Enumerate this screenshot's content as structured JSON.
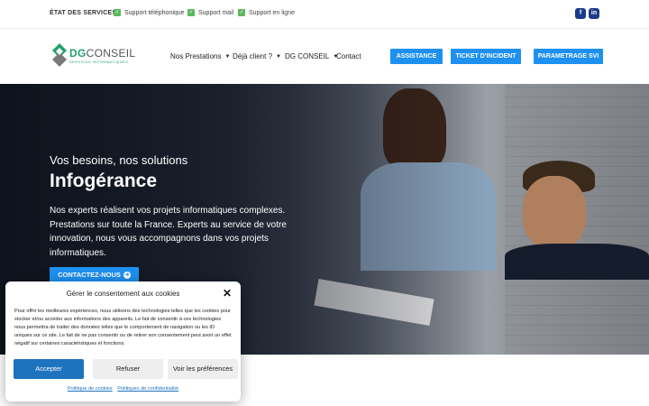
{
  "topbar": {
    "status_title": "ÉTAT DES SERVICES :",
    "services": [
      "Support téléphonique",
      "Support mail",
      "Support en ligne"
    ],
    "social": [
      "facebook-icon",
      "linkedin-icon"
    ]
  },
  "header": {
    "logo_dg": "DG",
    "logo_conseil": "CONSEIL",
    "logo_sub": "SERVICES INFORMATIQUES",
    "nav": [
      {
        "label": "Nos Prestations",
        "dropdown": true
      },
      {
        "label": "Déjà client ?",
        "dropdown": true
      },
      {
        "label": "DG CONSEIL",
        "dropdown": true
      },
      {
        "label": "Contact",
        "dropdown": false
      }
    ],
    "buttons": [
      "ASSISTANCE",
      "TICKET D'INCIDENT",
      "PARAMETRAGE SVI"
    ]
  },
  "hero": {
    "subtitle": "Vos besoins, nos solutions",
    "title": "Infogérance",
    "text": "Nos experts réalisent vos projets informatiques complexes. Prestations sur toute la France. Experts au service de votre innovation, nous vous accompagnons dans vos projets informatiques.",
    "cta": "CONTACTEZ-NOUS"
  },
  "cookie_modal": {
    "title": "Gérer le consentement aux cookies",
    "body": "Pour offrir les meilleures expériences, nous utilisons des technologies telles que les cookies pour stocker et/ou accéder aux informations des appareils. Le fait de consentir à ces technologies nous permettra de traiter des données telles que le comportement de navigation ou les ID uniques sur ce site. Le fait de ne pas consentir ou de retirer son consentement peut avoir un effet négatif sur certaines caractéristiques et fonctions.",
    "accept": "Accepter",
    "refuse": "Refuser",
    "preferences": "Voir les préférences",
    "link_cookies": "Politique de cookies",
    "link_privacy": "Politiques de confidentialité"
  },
  "colors": {
    "accent": "#1e90f0",
    "check": "#5cb85c",
    "brand_green": "#22a06b",
    "social": "#1d3a8a"
  }
}
